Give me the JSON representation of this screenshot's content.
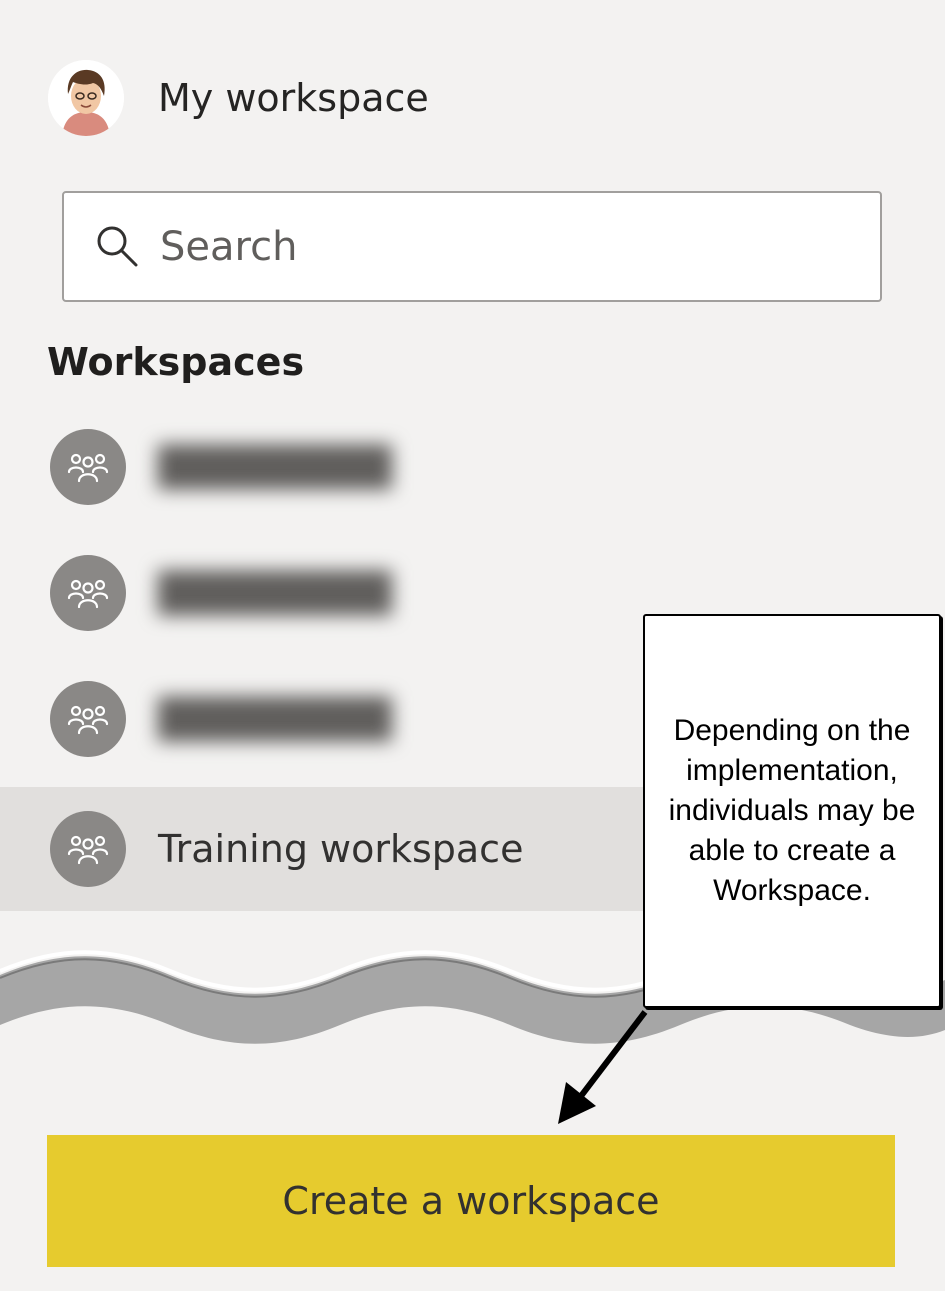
{
  "header": {
    "my_workspace_label": "My workspace"
  },
  "search": {
    "placeholder": "Search",
    "value": ""
  },
  "workspaces": {
    "heading": "Workspaces",
    "items": [
      {
        "label": "████████",
        "blurred": true
      },
      {
        "label": "████████",
        "blurred": true
      },
      {
        "label": "████████",
        "blurred": true
      },
      {
        "label": "Training workspace",
        "blurred": false,
        "selected": true
      }
    ]
  },
  "actions": {
    "create_label": "Create a workspace"
  },
  "callout": {
    "text": "Depending on the implementation, individuals may be able to create a Workspace."
  },
  "icons": {
    "avatar": "user-avatar",
    "search": "search-icon",
    "workspace": "group-icon"
  },
  "colors": {
    "background": "#f3f2f1",
    "selected_row": "#e1dfdd",
    "workspace_icon": "#8a8886",
    "create_button": "#e6cb2e"
  }
}
